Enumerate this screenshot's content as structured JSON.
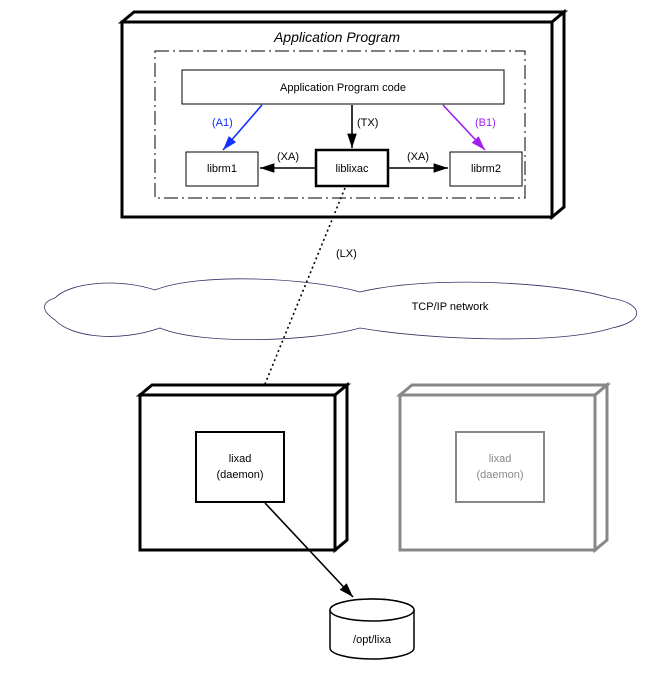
{
  "title": "Application Program",
  "app_code": "Application Program code",
  "librm1": "librm1",
  "liblixac": "liblixac",
  "librm2": "librm2",
  "a1": "(A1)",
  "b1": "(B1)",
  "tx": "(TX)",
  "xa": "(XA)",
  "lx": "(LX)",
  "network": "TCP/IP network",
  "lixad1_line1": "lixad",
  "lixad1_line2": "(daemon)",
  "lixad2_line1": "lixad",
  "lixad2_line2": "(daemon)",
  "optlixa": "/opt/lixa"
}
